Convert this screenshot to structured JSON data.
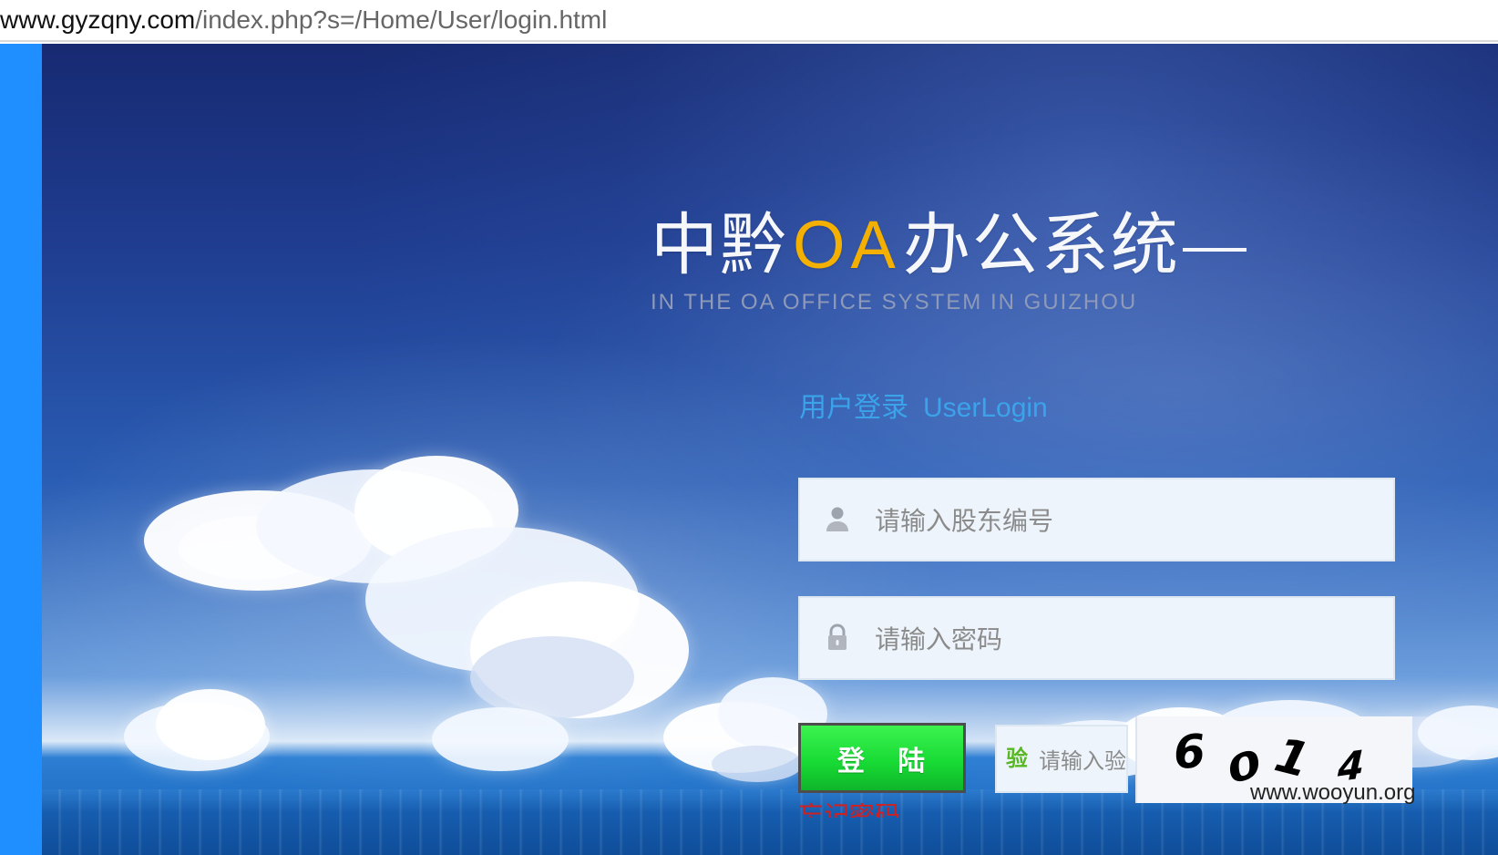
{
  "browser": {
    "host": "www.gyzqny.com",
    "path": "/index.php?s=/Home/User/login.html"
  },
  "hero": {
    "title_prefix": "中黔",
    "title_accent": "OA",
    "title_suffix": "办公系统",
    "title_dash": "—",
    "subtitle": "IN THE OA OFFICE SYSTEM IN GUIZHOU"
  },
  "login": {
    "heading_zh": "用户登录",
    "heading_en": "UserLogin",
    "username_placeholder": "请输入股东编号",
    "password_placeholder": "请输入密码",
    "button_label": "登 陆",
    "captcha_prefix": "验",
    "captcha_placeholder": "请输入验",
    "captcha_code": [
      "6",
      "0",
      "1",
      "4"
    ],
    "forgot_label": "忘记密码"
  },
  "overlay": {
    "watermark": "www.wooyun.org"
  },
  "colors": {
    "left_strip": "#1f8fff",
    "accent": "#f4b000",
    "heading": "#3ba3ea",
    "button": "#17da34",
    "forgot": "#d31f1f"
  },
  "icons": {
    "username": "user-icon",
    "password": "lock-icon"
  }
}
